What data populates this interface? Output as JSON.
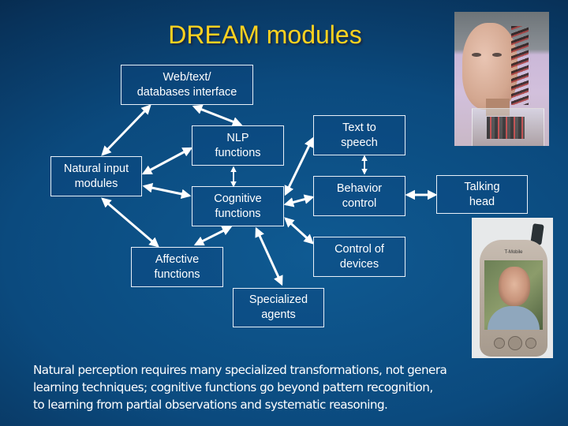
{
  "slide": {
    "title": "DREAM modules",
    "title_color": "#ffd21f",
    "background_color": "#0b4a7e"
  },
  "modules": {
    "web": {
      "line1": "Web/text/",
      "line2": "databases interface"
    },
    "nlp": {
      "line1": "NLP",
      "line2": "functions"
    },
    "natural_input": {
      "line1": "Natural input",
      "line2": "modules"
    },
    "cognitive": {
      "line1": "Cognitive",
      "line2": "functions"
    },
    "affective": {
      "line1": "Affective",
      "line2": "functions"
    },
    "specialized": {
      "line1": "Specialized",
      "line2": "agents"
    },
    "tts": {
      "line1": "Text to",
      "line2": "speech"
    },
    "behavior": {
      "line1": "Behavior",
      "line2": "control"
    },
    "devices": {
      "line1": "Control of",
      "line2": "devices"
    },
    "talking_head": {
      "line1": "Talking",
      "line2": "head"
    }
  },
  "connections": [
    [
      "web",
      "natural_input"
    ],
    [
      "web",
      "nlp"
    ],
    [
      "natural_input",
      "nlp"
    ],
    [
      "natural_input",
      "cognitive"
    ],
    [
      "natural_input",
      "affective"
    ],
    [
      "nlp",
      "cognitive"
    ],
    [
      "cognitive",
      "tts"
    ],
    [
      "cognitive",
      "behavior"
    ],
    [
      "cognitive",
      "devices"
    ],
    [
      "cognitive",
      "affective"
    ],
    [
      "cognitive",
      "specialized"
    ],
    [
      "tts",
      "behavior"
    ],
    [
      "behavior",
      "talking_head"
    ]
  ],
  "images": {
    "robot_head": "robot head photo",
    "pda": "PDA with face photo",
    "pda_brand": "T-Mobile"
  },
  "caption": {
    "line1": "Natural perception requires many specialized transformations, not genera",
    "line2": "learning techniques; cognitive functions go beyond pattern recognition,",
    "line3": "to learning from partial observations and systematic reasoning."
  }
}
